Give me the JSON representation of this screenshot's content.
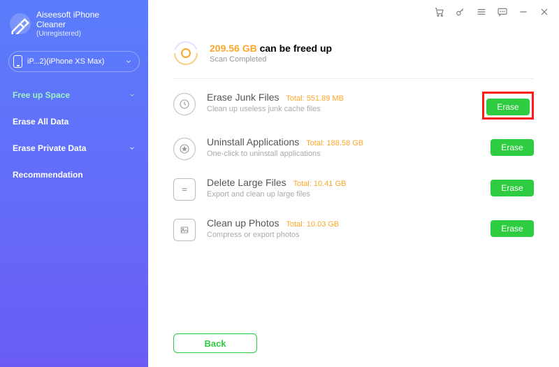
{
  "brand": {
    "title": "Aiseesoft iPhone",
    "subtitle": "Cleaner",
    "status": "(Unregistered)"
  },
  "device": {
    "label": "iP...2)(iPhone XS Max)"
  },
  "nav": {
    "free_up_space": "Free up Space",
    "erase_all_data": "Erase All Data",
    "erase_private_data": "Erase Private Data",
    "recommendation": "Recommendation"
  },
  "summary": {
    "amount": "209.56 GB",
    "suffix": "can be freed up",
    "status": "Scan Completed"
  },
  "labels": {
    "total_prefix": "Total:",
    "erase": "Erase",
    "back": "Back"
  },
  "items": {
    "junk": {
      "title": "Erase Junk Files",
      "total": "551.89 MB",
      "sub": "Clean up useless junk cache files"
    },
    "apps": {
      "title": "Uninstall Applications",
      "total": "188.58 GB",
      "sub": "One-click to uninstall applications"
    },
    "large": {
      "title": "Delete Large Files",
      "total": "10.41 GB",
      "sub": "Export and clean up large files"
    },
    "photos": {
      "title": "Clean up Photos",
      "total": "10.03 GB",
      "sub": "Compress or export photos"
    }
  }
}
